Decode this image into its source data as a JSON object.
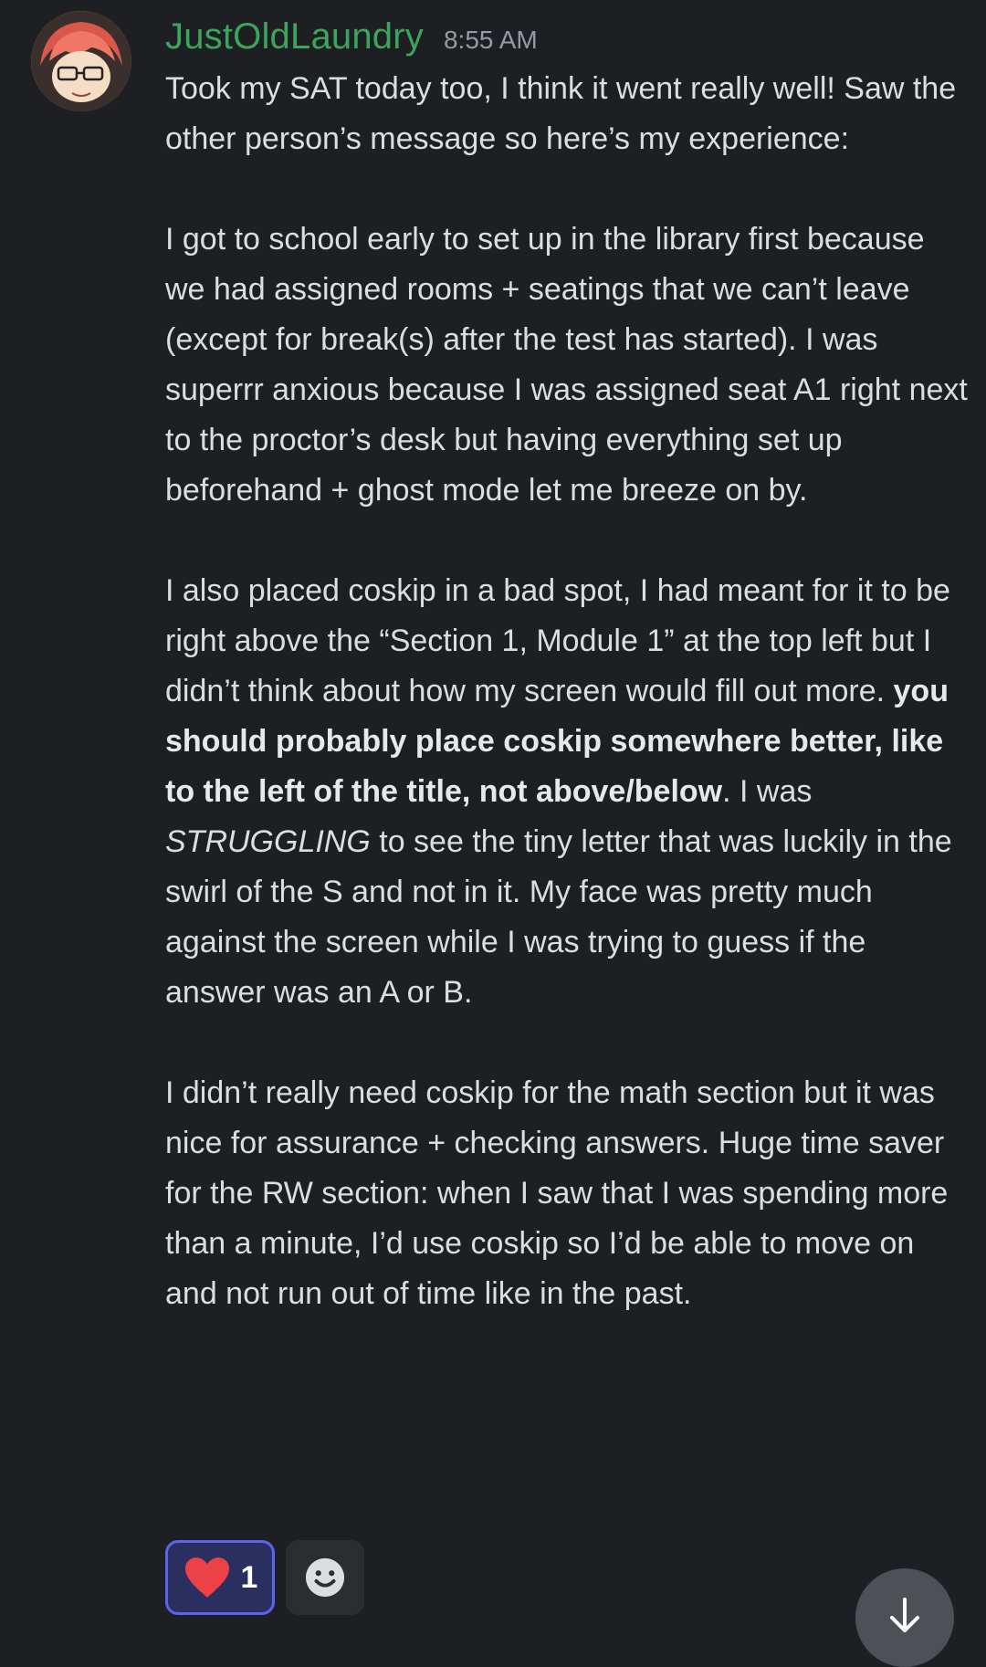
{
  "message": {
    "username": "JustOldLaundry",
    "timestamp": "8:55 AM",
    "paragraphs": [
      [
        {
          "text": "Took my SAT today too, I think it went really well! Saw the other person’s message so here’s my experience:",
          "style": "normal"
        }
      ],
      [
        {
          "text": "I got to school early to set up in the library first because we had assigned rooms + seatings that we can’t leave (except for break(s) after the test has started). I was superrr anxious because I was assigned seat A1 right next to the proctor’s desk but having everything set up beforehand + ghost mode let me breeze on by.",
          "style": "normal"
        }
      ],
      [
        {
          "text": "I also placed coskip in a bad spot, I had meant for it to be right above the “Section 1, Module 1” at the top left but I didn’t think about how my screen would fill out more. ",
          "style": "normal"
        },
        {
          "text": "you should probably place coskip somewhere better, like to the left of the title, not above/below",
          "style": "bold"
        },
        {
          "text": ". I was ",
          "style": "normal"
        },
        {
          "text": "STRUGGLING",
          "style": "italic"
        },
        {
          "text": " to see the tiny letter that was luckily in the swirl of the S and not in it. My face was pretty much against the screen while I was trying to guess if the answer was an A or B.",
          "style": "normal"
        }
      ],
      [
        {
          "text": "I didn’t really need coskip for the math section but it was nice for assurance + checking answers. Huge time saver for the RW section: when I saw that I was spending more than a minute, I’d use coskip so I’d be able to move on and not run out of time like in the past.",
          "style": "normal"
        }
      ]
    ],
    "reactions": [
      {
        "emoji": "heart-icon",
        "count": "1",
        "active": true
      }
    ]
  },
  "colors": {
    "background": "#1e1f22",
    "username": "#3ba55d",
    "timestamp": "#949ba4",
    "text": "#dbdee1",
    "reaction_active_bg": "#2b2f5f",
    "reaction_active_border": "#5865f2",
    "heart": "#ed4245"
  }
}
